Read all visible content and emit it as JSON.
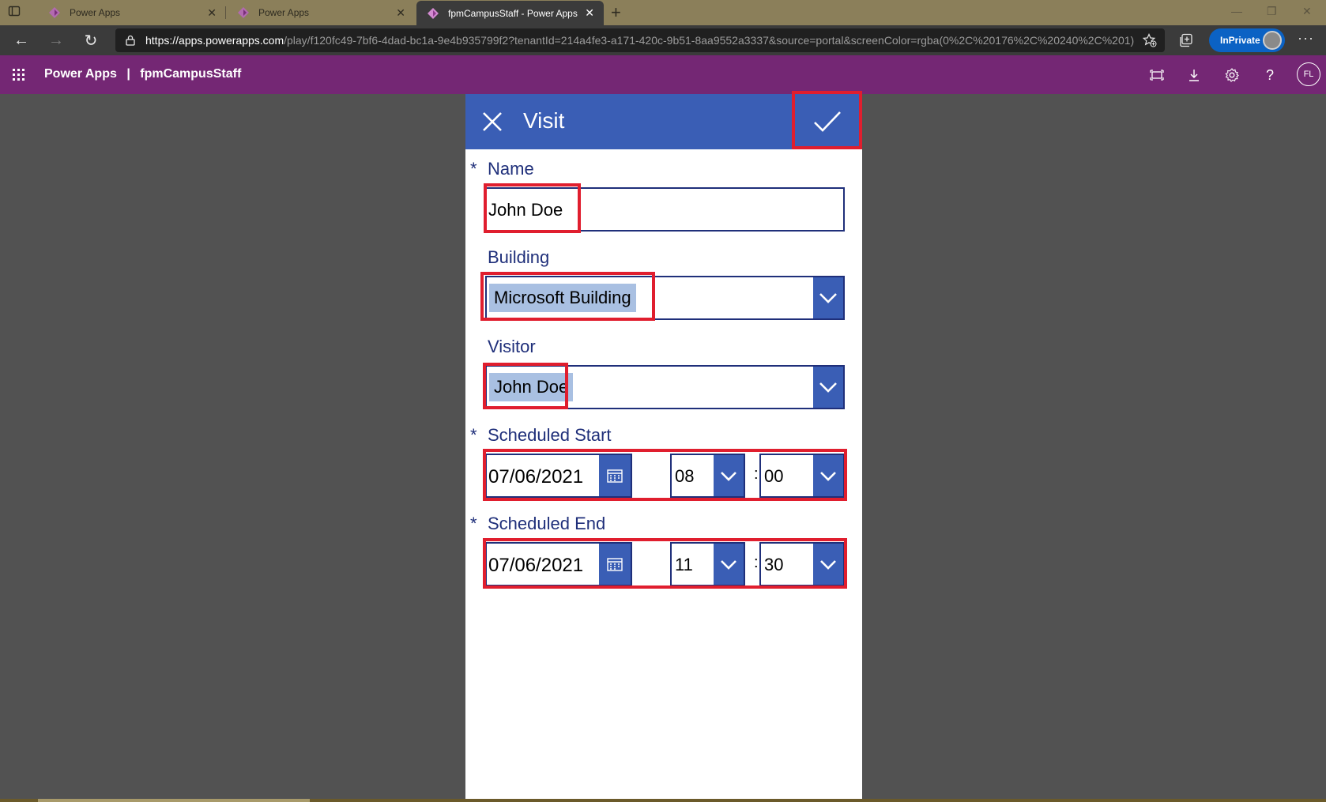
{
  "browser": {
    "tabs": [
      {
        "title": "Power Apps",
        "active": false
      },
      {
        "title": "Power Apps",
        "active": false
      },
      {
        "title": "fpmCampusStaff - Power Apps",
        "active": true
      }
    ],
    "url_prefix": "https://",
    "url_host": "apps.powerapps.com",
    "url_rest": "/play/f120fc49-7bf6-4dad-bc1a-9e4b935799f2?tenantId=214a4fe3-a171-420c-9b51-8aa9552a3337&source=portal&screenColor=rgba(0%2C%20176%2C%20240%2C%201)",
    "inprivate_label": "InPrivate"
  },
  "header": {
    "app_name": "Power Apps",
    "separator": "|",
    "app_title": "fpmCampusStaff",
    "user_initials": "FL",
    "help_label": "?"
  },
  "form": {
    "title": "Visit",
    "required_marker": "*",
    "name": {
      "label": "Name",
      "value": "John Doe"
    },
    "building": {
      "label": "Building",
      "value": "Microsoft Building"
    },
    "visitor": {
      "label": "Visitor",
      "value": "John Doe"
    },
    "scheduled_start": {
      "label": "Scheduled Start",
      "date": "07/06/2021",
      "hour": "08",
      "minute": "00"
    },
    "scheduled_end": {
      "label": "Scheduled End",
      "date": "07/06/2021",
      "hour": "11",
      "minute": "30"
    },
    "time_separator": ":"
  },
  "colors": {
    "powerapps_header": "#742774",
    "form_header": "#3a5eb5",
    "label_text": "#1f2f7a",
    "highlight": "#e01e2e",
    "selection": "#a9c0e2"
  }
}
